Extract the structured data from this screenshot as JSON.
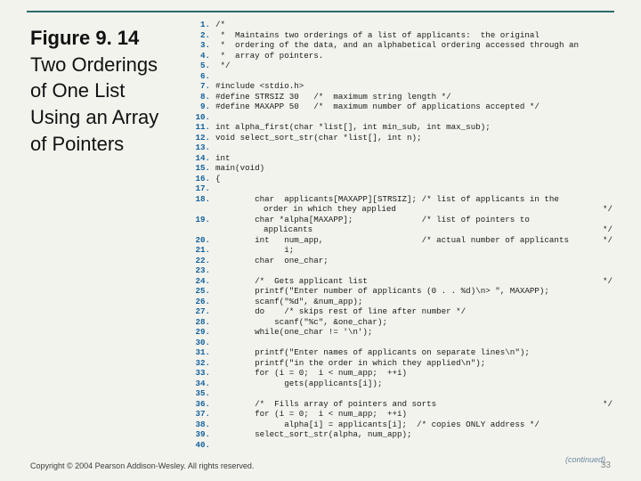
{
  "title": {
    "figure_label": "Figure 9. 14",
    "text_lines": [
      "Two Orderings",
      "of One List",
      "Using an Array",
      "of Pointers"
    ]
  },
  "code": [
    {
      "n": "1.",
      "t": "/*"
    },
    {
      "n": "2.",
      "t": " *  Maintains two orderings of a list of applicants:  the original"
    },
    {
      "n": "3.",
      "t": " *  ordering of the data, and an alphabetical ordering accessed through an"
    },
    {
      "n": "4.",
      "t": " *  array of pointers."
    },
    {
      "n": "5.",
      "t": " */"
    },
    {
      "n": "6.",
      "t": ""
    },
    {
      "n": "7.",
      "t": "#include <stdio.h>"
    },
    {
      "n": "8.",
      "t": "#define STRSIZ 30   /*  maximum string length */"
    },
    {
      "n": "9.",
      "t": "#define MAXAPP 50   /*  maximum number of applications accepted */"
    },
    {
      "n": "10.",
      "t": ""
    },
    {
      "n": "11.",
      "t": "int alpha_first(char *list[], int min_sub, int max_sub);"
    },
    {
      "n": "12.",
      "t": "void select_sort_str(char *list[], int n);"
    },
    {
      "n": "13.",
      "t": ""
    },
    {
      "n": "14.",
      "t": "int"
    },
    {
      "n": "15.",
      "t": "main(void)"
    },
    {
      "n": "16.",
      "t": "{"
    },
    {
      "n": "17.",
      "t": ""
    },
    {
      "n": "18.",
      "t": "        char  applicants[MAXAPP][STRSIZ]; /* list of applicants in the"
    },
    {
      "n": "",
      "t": "",
      "cont": "order in which they applied",
      "r": "*/"
    },
    {
      "n": "19.",
      "t": "        char *alpha[MAXAPP];              /* list of pointers to"
    },
    {
      "n": "",
      "t": "",
      "cont": "applicants",
      "r": "*/"
    },
    {
      "n": "20.",
      "t": "        int   num_app,                    /* actual number of applicants",
      "r": "*/"
    },
    {
      "n": "21.",
      "t": "              i;"
    },
    {
      "n": "22.",
      "t": "        char  one_char;"
    },
    {
      "n": "23.",
      "t": ""
    },
    {
      "n": "24.",
      "t": "        /*  Gets applicant list",
      "r": "*/"
    },
    {
      "n": "25.",
      "t": "        printf(\"Enter number of applicants (0 . . %d)\\n> \", MAXAPP);"
    },
    {
      "n": "26.",
      "t": "        scanf(\"%d\", &num_app);"
    },
    {
      "n": "27.",
      "t": "        do    /* skips rest of line after number */"
    },
    {
      "n": "28.",
      "t": "            scanf(\"%c\", &one_char);"
    },
    {
      "n": "29.",
      "t": "        while(one_char != '\\n');"
    },
    {
      "n": "30.",
      "t": ""
    },
    {
      "n": "31.",
      "t": "        printf(\"Enter names of applicants on separate lines\\n\");"
    },
    {
      "n": "32.",
      "t": "        printf(\"in the order in which they applied\\n\");"
    },
    {
      "n": "33.",
      "t": "        for (i = 0;  i < num_app;  ++i)"
    },
    {
      "n": "34.",
      "t": "              gets(applicants[i]);"
    },
    {
      "n": "35.",
      "t": ""
    },
    {
      "n": "36.",
      "t": "        /*  Fills array of pointers and sorts",
      "r": "*/"
    },
    {
      "n": "37.",
      "t": "        for (i = 0;  i < num_app;  ++i)"
    },
    {
      "n": "38.",
      "t": "              alpha[i] = applicants[i];  /* copies ONLY address */"
    },
    {
      "n": "39.",
      "t": "        select_sort_str(alpha, num_app);"
    },
    {
      "n": "40.",
      "t": ""
    }
  ],
  "footer": {
    "continued": "(continued)",
    "pagenum": "33",
    "copyright": "Copyright © 2004 Pearson Addison-Wesley. All rights reserved."
  }
}
